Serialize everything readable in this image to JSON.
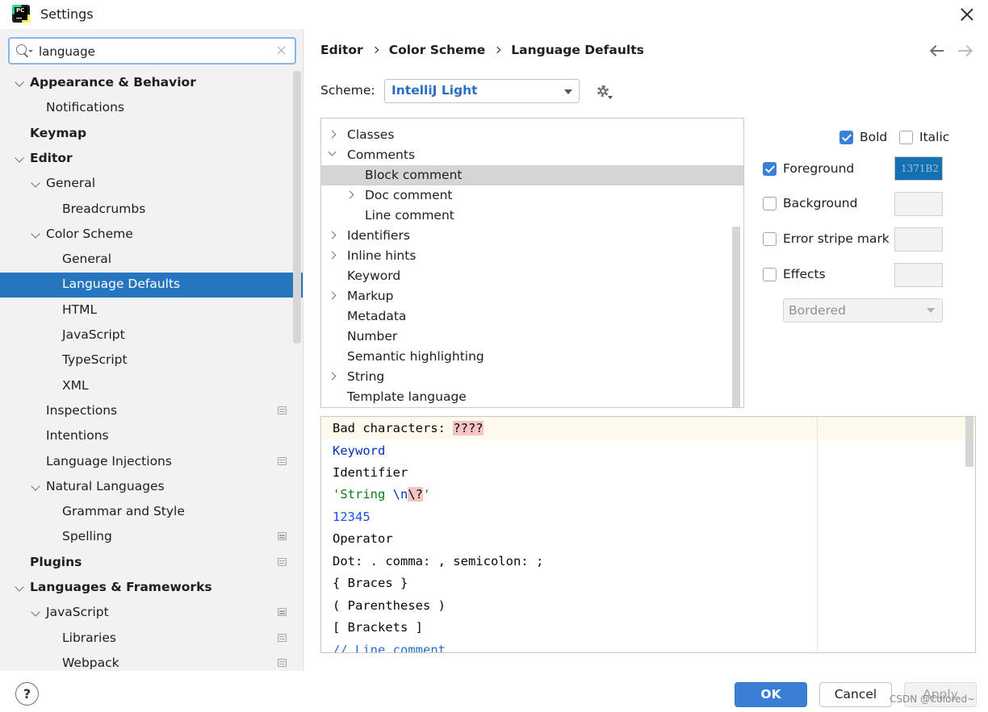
{
  "window": {
    "title": "Settings"
  },
  "search": {
    "value": "language"
  },
  "tree": [
    {
      "label": "Appearance & Behavior",
      "bold": true,
      "expanded": true
    },
    {
      "label": "Notifications"
    },
    {
      "label": "Keymap",
      "bold": true
    },
    {
      "label": "Editor",
      "bold": true,
      "expanded": true
    },
    {
      "label": "General",
      "expanded": true
    },
    {
      "label": "Breadcrumbs"
    },
    {
      "label": "Color Scheme",
      "expanded": true
    },
    {
      "label": "General"
    },
    {
      "label": "Language Defaults",
      "selected": true
    },
    {
      "label": "HTML"
    },
    {
      "label": "JavaScript"
    },
    {
      "label": "TypeScript"
    },
    {
      "label": "XML"
    },
    {
      "label": "Inspections",
      "icon": "project-icon"
    },
    {
      "label": "Intentions"
    },
    {
      "label": "Language Injections",
      "icon": "project-icon"
    },
    {
      "label": "Natural Languages",
      "expanded": true
    },
    {
      "label": "Grammar and Style"
    },
    {
      "label": "Spelling",
      "icon": "project-icon"
    },
    {
      "label": "Plugins",
      "bold": true,
      "icon": "project-icon"
    },
    {
      "label": "Languages & Frameworks",
      "bold": true,
      "expanded": true
    },
    {
      "label": "JavaScript",
      "expanded": true,
      "icon": "project-icon"
    },
    {
      "label": "Libraries",
      "icon": "project-icon"
    },
    {
      "label": "Webpack",
      "icon": "project-icon"
    }
  ],
  "breadcrumbs": [
    "Editor",
    "Color Scheme",
    "Language Defaults"
  ],
  "scheme": {
    "label": "Scheme:",
    "value": "IntelliJ Light"
  },
  "attributes": [
    {
      "label": "Classes",
      "chevron": "right"
    },
    {
      "label": "Comments",
      "chevron": "down"
    },
    {
      "label": "Block comment",
      "selected": true
    },
    {
      "label": "Doc comment",
      "chevron": "right"
    },
    {
      "label": "Line comment"
    },
    {
      "label": "Identifiers",
      "chevron": "right"
    },
    {
      "label": "Inline hints",
      "chevron": "right"
    },
    {
      "label": "Keyword"
    },
    {
      "label": "Markup",
      "chevron": "right"
    },
    {
      "label": "Metadata"
    },
    {
      "label": "Number"
    },
    {
      "label": "Semantic highlighting"
    },
    {
      "label": "String",
      "chevron": "right"
    },
    {
      "label": "Template language"
    }
  ],
  "options": {
    "bold": {
      "label": "Bold",
      "checked": true
    },
    "italic": {
      "label": "Italic",
      "checked": false
    },
    "foreground": {
      "label": "Foreground",
      "checked": true,
      "color": "1371B2"
    },
    "background": {
      "label": "Background",
      "checked": false
    },
    "error_stripe": {
      "label": "Error stripe mark",
      "checked": false
    },
    "effects": {
      "label": "Effects",
      "checked": false,
      "type": "Bordered"
    }
  },
  "preview": {
    "bad_prefix": "Bad characters: ",
    "bad_chars": "????",
    "keyword": "Keyword",
    "identifier": "Identifier",
    "string_a": "'String ",
    "string_escape": "\\n",
    "string_bad": "\\?",
    "string_end": "'",
    "number": "12345",
    "operator": "Operator",
    "dot": "Dot: . comma: , semicolon: ;",
    "braces": "{ Braces }",
    "parens": "( Parentheses )",
    "brackets": "[ Brackets ]",
    "line_comment": "// Line comment"
  },
  "buttons": {
    "ok": "OK",
    "cancel": "Cancel",
    "apply": "Apply",
    "help": "?"
  },
  "watermark": "CSDN @Colored~",
  "colors": {
    "accent": "#2675bf",
    "foreground_swatch": "#1371b2",
    "scheme_text": "#2b6ec9"
  }
}
